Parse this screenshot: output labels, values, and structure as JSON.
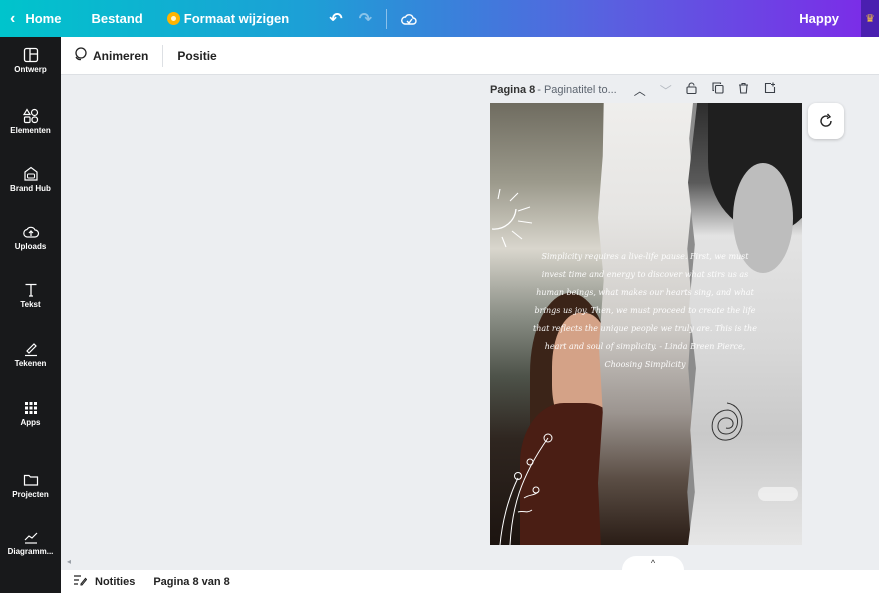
{
  "topbar": {
    "home_label": "Home",
    "file_label": "Bestand",
    "resize_label": "Formaat wijzigen",
    "user_label": "Happy",
    "undo_icon": "undo-icon",
    "redo_icon": "redo-icon",
    "cloud_icon": "cloud-saved-icon"
  },
  "sidebar": {
    "items": [
      {
        "label": "Ontwerp",
        "icon": "layout-icon"
      },
      {
        "label": "Elementen",
        "icon": "shapes-icon"
      },
      {
        "label": "Brand Hub",
        "icon": "brand-icon"
      },
      {
        "label": "Uploads",
        "icon": "upload-cloud-icon"
      },
      {
        "label": "Tekst",
        "icon": "text-icon"
      },
      {
        "label": "Tekenen",
        "icon": "draw-icon"
      },
      {
        "label": "Apps",
        "icon": "apps-grid-icon"
      },
      {
        "label": "Projecten",
        "icon": "folder-icon"
      },
      {
        "label": "Diagramm...",
        "icon": "chart-icon"
      }
    ]
  },
  "toolbar": {
    "animate_label": "Animeren",
    "position_label": "Positie"
  },
  "page_header": {
    "title": "Pagina 8",
    "subtitle": " - Paginatitel to..."
  },
  "canvas": {
    "quote": "Simplicity requires a live-life pause. First, we must invest time and energy to discover what stirs us as human beings, what makes our hearts sing, and what brings us joy. Then, we must proceed to create the life that reflects the unique people we truly are. This is the heart and soul of simplicity. - Linda Breen Pierce, Choosing Simplicity"
  },
  "footer": {
    "notes_label": "Notities",
    "page_indicator": "Pagina 8 van 8"
  },
  "colors": {
    "sidebar_bg": "#18191b",
    "topbar_gradient_start": "#00c4cc",
    "topbar_gradient_end": "#7d2ae8",
    "canvas_bg": "#eceef1"
  }
}
